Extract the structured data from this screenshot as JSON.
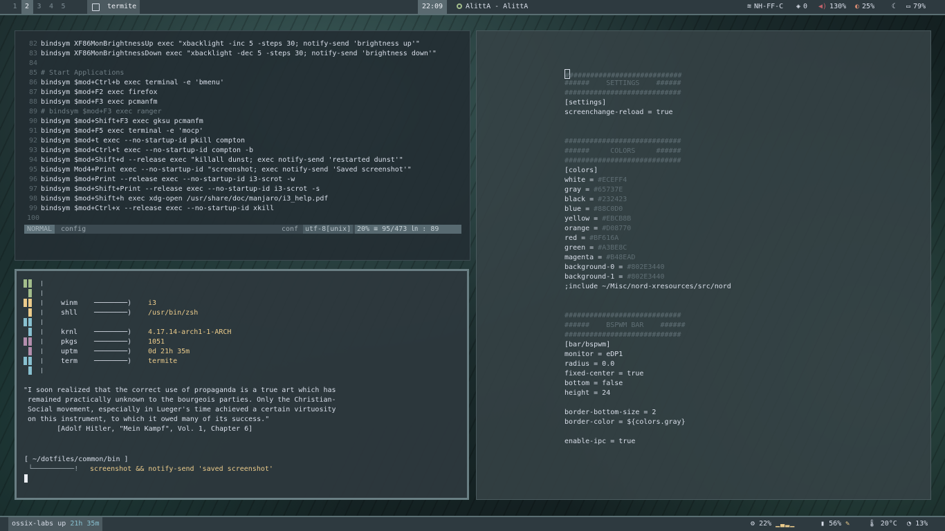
{
  "topbar": {
    "workspaces": [
      "1",
      "2",
      "3",
      "4",
      "5"
    ],
    "active_workspace": "2",
    "window_label": "termite",
    "clock": "22:09",
    "title": "AlittA - AlittA",
    "wifi": "NH-FF-C",
    "updates": "0",
    "volume": "130%",
    "brightness": "25%",
    "battery": "79%"
  },
  "editor": {
    "lines": [
      {
        "n": "82",
        "t": "bindsym XF86MonBrightnessUp exec \"xbacklight -inc 5 -steps 30; notify-send 'brightness up'\""
      },
      {
        "n": "83",
        "t": "bindsym XF86MonBrightnessDown exec \"xbacklight -dec 5 -steps 30; notify-send 'brightness down'\""
      },
      {
        "n": "84",
        "t": ""
      },
      {
        "n": "85",
        "t": "# Start Applications",
        "c": true
      },
      {
        "n": "86",
        "t": "bindsym $mod+Ctrl+b exec terminal -e 'bmenu'"
      },
      {
        "n": "87",
        "t": "bindsym $mod+F2 exec firefox"
      },
      {
        "n": "88",
        "t": "bindsym $mod+F3 exec pcmanfm"
      },
      {
        "n": "89",
        "t": "# bindsym $mod+F3 exec ranger",
        "c": true
      },
      {
        "n": "90",
        "t": "bindsym $mod+Shift+F3 exec gksu pcmanfm"
      },
      {
        "n": "91",
        "t": "bindsym $mod+F5 exec terminal -e 'mocp'"
      },
      {
        "n": "92",
        "t": "bindsym $mod+t exec --no-startup-id pkill compton"
      },
      {
        "n": "93",
        "t": "bindsym $mod+Ctrl+t exec --no-startup-id compton -b"
      },
      {
        "n": "94",
        "t": "bindsym $mod+Shift+d --release exec \"killall dunst; exec notify-send 'restarted dunst'\""
      },
      {
        "n": "95",
        "t": "bindsym Mod4+Print exec --no-startup-id \"screenshot; exec notify-send 'Saved screenshot'\""
      },
      {
        "n": "96",
        "t": "bindsym $mod+Print --release exec --no-startup-id i3-scrot -w"
      },
      {
        "n": "97",
        "t": "bindsym $mod+Shift+Print --release exec --no-startup-id i3-scrot -s"
      },
      {
        "n": "98",
        "t": "bindsym $mod+Shift+h exec xdg-open /usr/share/doc/manjaro/i3_help.pdf"
      },
      {
        "n": "99",
        "t": "bindsym $mod+Ctrl+x --release exec --no-startup-id xkill"
      },
      {
        "n": "100",
        "t": ""
      }
    ],
    "status": {
      "mode": "NORMAL",
      "file": "config",
      "ft": "conf",
      "encoding": "utf-8[unix]",
      "percent": "20% ≡",
      "position": "95/473 ㏑ : 89"
    }
  },
  "fetch": {
    "rows": [
      {
        "k": "winm",
        "v": "i3"
      },
      {
        "k": "shll",
        "v": "/usr/bin/zsh"
      },
      {
        "k": "krnl",
        "v": "4.17.14-arch1-1-ARCH"
      },
      {
        "k": "pkgs",
        "v": "1051"
      },
      {
        "k": "uptm",
        "v": "0d 21h 35m"
      },
      {
        "k": "term",
        "v": "termite"
      }
    ],
    "arrow": "────────)",
    "quote": [
      "\"I soon realized that the correct use of propaganda is a true art which has",
      " remained practically unknown to the bourgeois parties. Only the Christian-",
      " Social movement, especially in Lueger's time achieved a certain virtuosity",
      " on this instrument, to which it owed many of its success.\"",
      "        [Adolf Hitler, \"Mein Kampf\", Vol. 1, Chapter 6]"
    ],
    "prompt_path": "[ ~/dotfiles/common/bin ]",
    "prompt_branch": " └──────────!",
    "command": "screenshot && notify-send 'saved screenshot'"
  },
  "polybar": {
    "lines": [
      {
        "t": "############################",
        "d": true,
        "cur": true
      },
      {
        "t": "######    SETTINGS    ######",
        "d": true
      },
      {
        "t": "############################",
        "d": true
      },
      {
        "t": "[settings]"
      },
      {
        "t": "screenchange-reload = true"
      },
      {
        "t": ""
      },
      {
        "t": ""
      },
      {
        "t": "############################",
        "d": true
      },
      {
        "t": "######     COLORS     ######",
        "d": true
      },
      {
        "t": "############################",
        "d": true
      },
      {
        "t": "[colors]"
      },
      {
        "k": "white = ",
        "v": "#ECEFF4"
      },
      {
        "k": "gray = ",
        "v": "#65737E"
      },
      {
        "k": "black = ",
        "v": "#232423"
      },
      {
        "k": "blue = ",
        "v": "#88C0D0"
      },
      {
        "k": "yellow = ",
        "v": "#EBCB8B"
      },
      {
        "k": "orange = ",
        "v": "#D08770"
      },
      {
        "k": "red = ",
        "v": "#BF616A"
      },
      {
        "k": "green = ",
        "v": "#A3BE8C"
      },
      {
        "k": "magenta = ",
        "v": "#B48EAD"
      },
      {
        "k": "background-0 = ",
        "v": "#802E3440"
      },
      {
        "k": "background-1 = ",
        "v": "#802E3440"
      },
      {
        "t": ";include ~/Misc/nord-xresources/src/nord"
      },
      {
        "t": ""
      },
      {
        "t": ""
      },
      {
        "t": "############################",
        "d": true
      },
      {
        "t": "######    BSPWM BAR    ######",
        "d": true
      },
      {
        "t": "############################",
        "d": true
      },
      {
        "t": "[bar/bspwm]"
      },
      {
        "t": "monitor = eDP1"
      },
      {
        "t": "radius = 0.0"
      },
      {
        "t": "fixed-center = true"
      },
      {
        "t": "bottom = false"
      },
      {
        "t": "height = 24"
      },
      {
        "t": ""
      },
      {
        "t": "border-bottom-size = 2"
      },
      {
        "t": "border-color = ${colors.gray}"
      },
      {
        "t": ""
      },
      {
        "t": "enable-ipc = true"
      }
    ]
  },
  "bottombar": {
    "host": "ossix-labs",
    "up_label": "up",
    "uptime": "21h 35m",
    "cpu": "22%",
    "mem": "56%",
    "temp": "20°C",
    "disk": "13%"
  },
  "colors": {
    "block_green": "#a3be8c",
    "block_yellow": "#ebcb8b",
    "block_blue": "#88c0d0",
    "block_magenta": "#b48ead"
  }
}
